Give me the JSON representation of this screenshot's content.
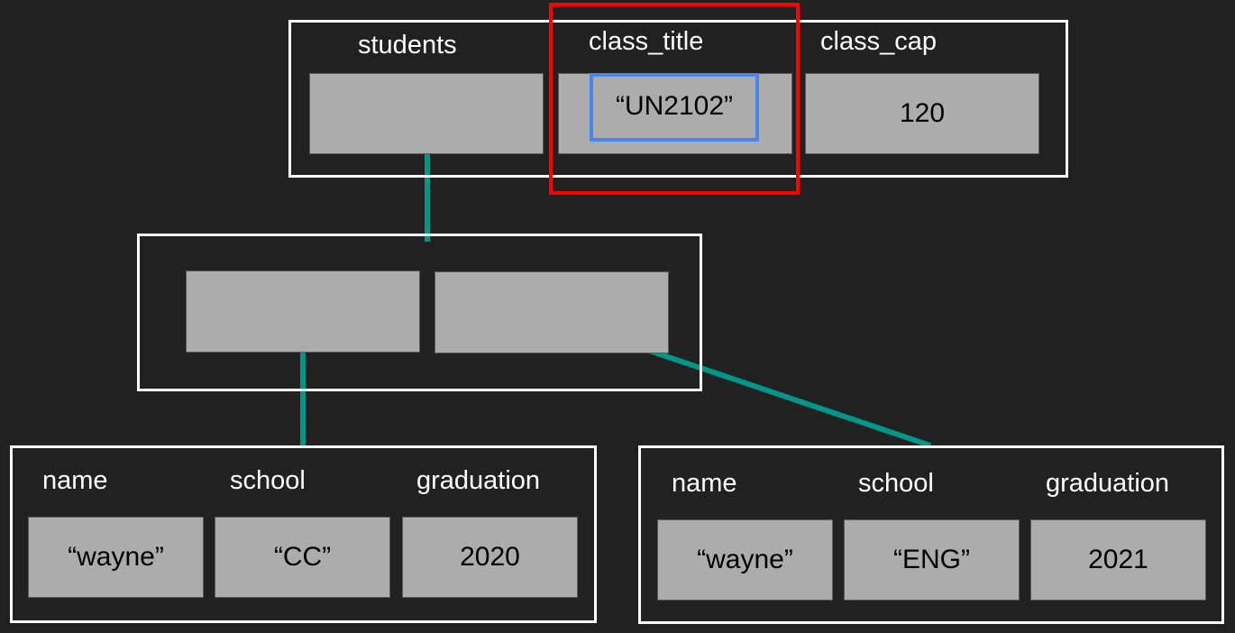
{
  "class_record": {
    "labels": {
      "students": "students",
      "class_title": "class_title",
      "class_cap": "class_cap"
    },
    "values": {
      "students": "",
      "class_title": "“UN2102”",
      "class_cap": "120"
    }
  },
  "students_array": {
    "slots": [
      "",
      ""
    ]
  },
  "student_records": [
    {
      "labels": {
        "name": "name",
        "school": "school",
        "graduation": "graduation"
      },
      "values": {
        "name": "“wayne”",
        "school": "“CC”",
        "graduation": "2020"
      }
    },
    {
      "labels": {
        "name": "name",
        "school": "school",
        "graduation": "graduation"
      },
      "values": {
        "name": "“wayne”",
        "school": "“ENG”",
        "graduation": "2021"
      }
    }
  ],
  "colors": {
    "background": "#212121",
    "frame": "#ffffff",
    "cell": "#acacac",
    "pointer_line": "#009688",
    "highlight_outer": "#ff0000",
    "highlight_inner": "#4a86e8"
  }
}
